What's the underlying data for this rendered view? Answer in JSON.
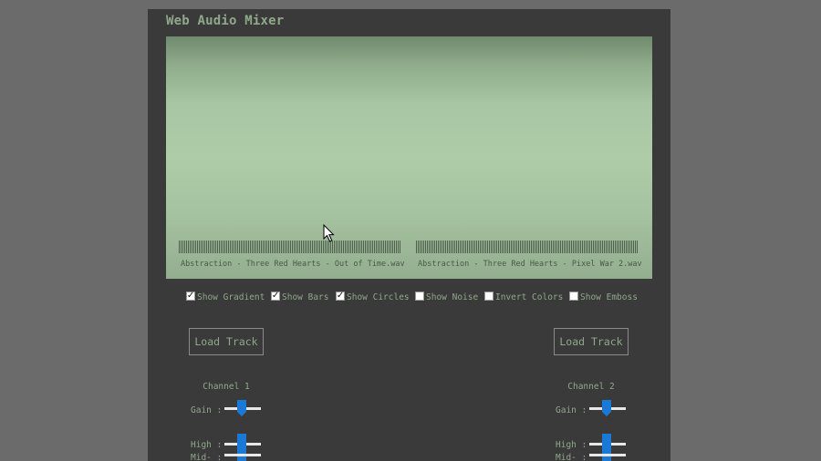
{
  "app": {
    "title": "Web Audio Mixer"
  },
  "visualizer": {
    "tracks": [
      {
        "label": "Abstraction - Three Red Hearts - Out of Time.wav"
      },
      {
        "label": "Abstraction - Three Red Hearts - Pixel War 2.wav"
      }
    ]
  },
  "options": [
    {
      "label": "Show Gradient",
      "checked": true
    },
    {
      "label": "Show Bars",
      "checked": true
    },
    {
      "label": "Show Circles",
      "checked": true
    },
    {
      "label": "Show Noise",
      "checked": false
    },
    {
      "label": "Invert Colors",
      "checked": false
    },
    {
      "label": "Show Emboss",
      "checked": false
    }
  ],
  "channels": [
    {
      "load_label": "Load Track",
      "title": "Channel 1",
      "gain_label": "Gain :",
      "high_label": "High :",
      "mid_label": "Mid- :"
    },
    {
      "load_label": "Load Track",
      "title": "Channel 2",
      "gain_label": "Gain :",
      "high_label": "High :",
      "mid_label": "Mid- :"
    }
  ],
  "colors": {
    "accent_text": "#8fa88a",
    "slider_thumb": "#1a79d6",
    "panel_bg": "#3a3a3a"
  }
}
